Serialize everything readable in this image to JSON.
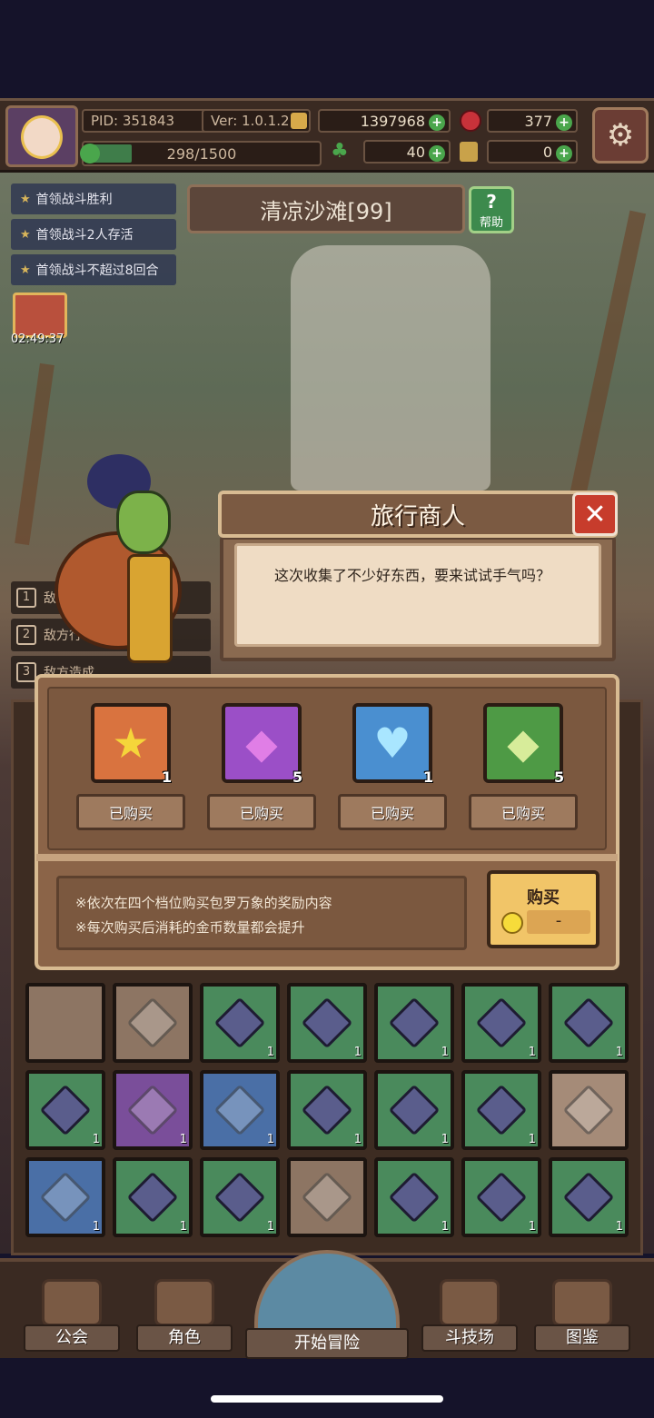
{
  "status": {
    "pid": "PID: 351843",
    "version": "Ver: 1.0.1.2",
    "gold": "1397968",
    "ruby": "377",
    "xp": "298/1500",
    "xp_fraction": 0.199,
    "clover": "40",
    "key": "0"
  },
  "quests": [
    "首领战斗胜利",
    "首领战斗2人存活",
    "首领战斗不超过8回合"
  ],
  "timer": "02:49:37",
  "stage": {
    "name": "清凉沙滩[99]",
    "help_label": "帮助"
  },
  "log": [
    {
      "num": "1",
      "text": "敌人"
    },
    {
      "num": "2",
      "text": "敌方行动力"
    },
    {
      "num": "3",
      "text": "敌方造成"
    }
  ],
  "dialog": {
    "title": "旅行商人",
    "text": "这次收集了不少好东西，要来试试手气吗？"
  },
  "shop": {
    "items": [
      {
        "icon": "star-icon",
        "glyph": "★",
        "color": "#d9733f",
        "glyph_color": "#f5d53a",
        "count": "1",
        "status": "已购买"
      },
      {
        "icon": "purple-gem-icon",
        "glyph": "◆",
        "color": "#9b4fc7",
        "glyph_color": "#e07ee6",
        "count": "5",
        "status": "已购买"
      },
      {
        "icon": "blue-heart-icon",
        "glyph": "♥",
        "color": "#4a8fd0",
        "glyph_color": "#a9e6ff",
        "count": "1",
        "status": "已购买"
      },
      {
        "icon": "green-gem-icon",
        "glyph": "◆",
        "color": "#4e9a45",
        "glyph_color": "#d7ec9a",
        "count": "5",
        "status": "已购买"
      }
    ],
    "notes": [
      "※依次在四个档位购买包罗万象的奖励内容",
      "※每次购买后消耗的金币数量都会提升"
    ],
    "buy_label": "购买",
    "price": "-"
  },
  "inventory": {
    "rows": [
      [
        {
          "type": "empty",
          "color": "#8d7563"
        },
        {
          "type": "sheep",
          "color": "#8d7563"
        },
        {
          "type": "gem",
          "color": "#4a8a5c",
          "count": "1"
        },
        {
          "type": "gem",
          "color": "#4a8a5c",
          "count": "1"
        },
        {
          "type": "gem",
          "color": "#4a8a5c",
          "count": "1"
        },
        {
          "type": "gem",
          "color": "#4a8a5c",
          "count": "1"
        },
        {
          "type": "gem",
          "color": "#4a8a5c",
          "count": "1"
        }
      ],
      [
        {
          "type": "gem",
          "color": "#4a8a5c",
          "count": "1"
        },
        {
          "type": "armor",
          "color": "#7a4e9a",
          "count": "1"
        },
        {
          "type": "bottle",
          "color": "#4a6fa6",
          "count": "1"
        },
        {
          "type": "gem",
          "color": "#4a8a5c",
          "count": "1"
        },
        {
          "type": "gem",
          "color": "#4a8a5c",
          "count": "1"
        },
        {
          "type": "gem",
          "color": "#4a8a5c",
          "count": "1"
        },
        {
          "type": "cloud",
          "color": "#a58b78"
        }
      ],
      [
        {
          "type": "treasure",
          "color": "#4a6fa6",
          "count": "1"
        },
        {
          "type": "gem",
          "color": "#4a8a5c",
          "count": "1"
        },
        {
          "type": "gem",
          "color": "#4a8a5c",
          "count": "1"
        },
        {
          "type": "pot",
          "color": "#8d7563"
        },
        {
          "type": "gem",
          "color": "#4a8a5c",
          "count": "1"
        },
        {
          "type": "gem",
          "color": "#4a8a5c",
          "count": "1"
        },
        {
          "type": "gem",
          "color": "#4a8a5c",
          "count": "1"
        }
      ]
    ]
  },
  "nav": {
    "guild": "公会",
    "character": "角色",
    "start": "开始冒险",
    "arena": "斗技场",
    "codex": "图鉴"
  },
  "colors": {
    "accent_green": "#4aa64c",
    "close_red": "#c73c2c",
    "buy_gold": "#f1c568"
  }
}
